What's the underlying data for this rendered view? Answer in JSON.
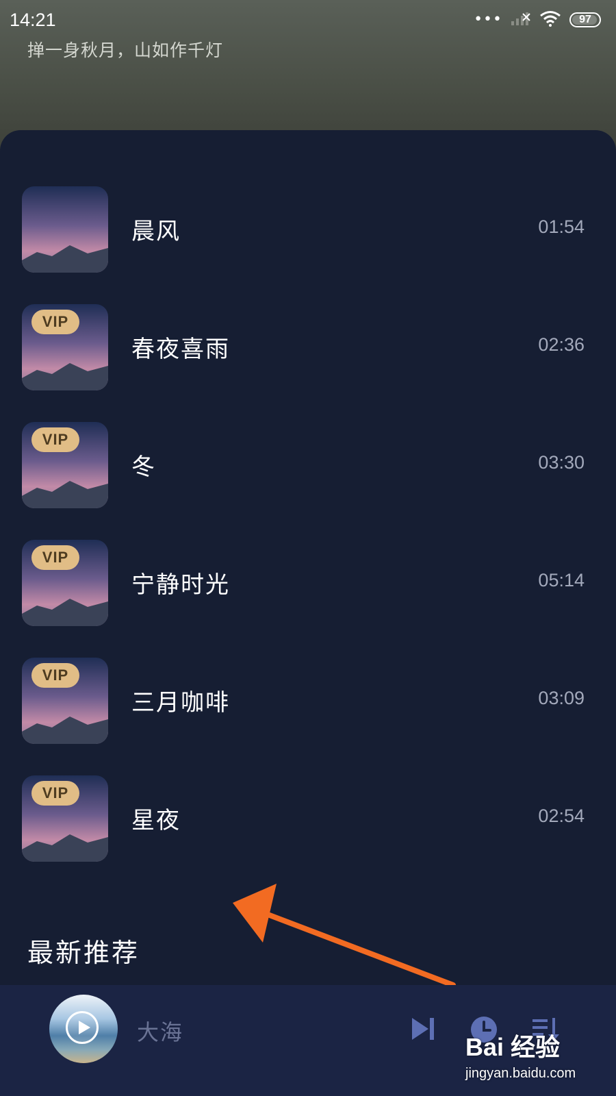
{
  "status_bar": {
    "time": "14:21",
    "battery": "97"
  },
  "header": {
    "subtitle": "掸一身秋月，山如作千灯"
  },
  "tracks": [
    {
      "title": "晨风",
      "duration": "01:54",
      "vip": false
    },
    {
      "title": "春夜喜雨",
      "duration": "02:36",
      "vip": true
    },
    {
      "title": "冬",
      "duration": "03:30",
      "vip": true
    },
    {
      "title": "宁静时光",
      "duration": "05:14",
      "vip": true
    },
    {
      "title": "三月咖啡",
      "duration": "03:09",
      "vip": true
    },
    {
      "title": "星夜",
      "duration": "02:54",
      "vip": true
    }
  ],
  "vip_label": "VIP",
  "section": {
    "heading": "最新推荐"
  },
  "player": {
    "title": "大海"
  },
  "watermark": {
    "brand": "Bai 经验",
    "url": "jingyan.baidu.com"
  },
  "colors": {
    "background": "#161e33",
    "player_bar": "#1b2444",
    "vip_badge": "#e1bd86",
    "arrow": "#f26b22",
    "control_icons": "#5d6fb4"
  },
  "icons": {
    "status": [
      "signal-dots-icon",
      "signal-bars-icon",
      "wifi-icon",
      "battery-icon"
    ],
    "controls": [
      "next-track-icon",
      "timer-icon",
      "playlist-icon"
    ]
  }
}
